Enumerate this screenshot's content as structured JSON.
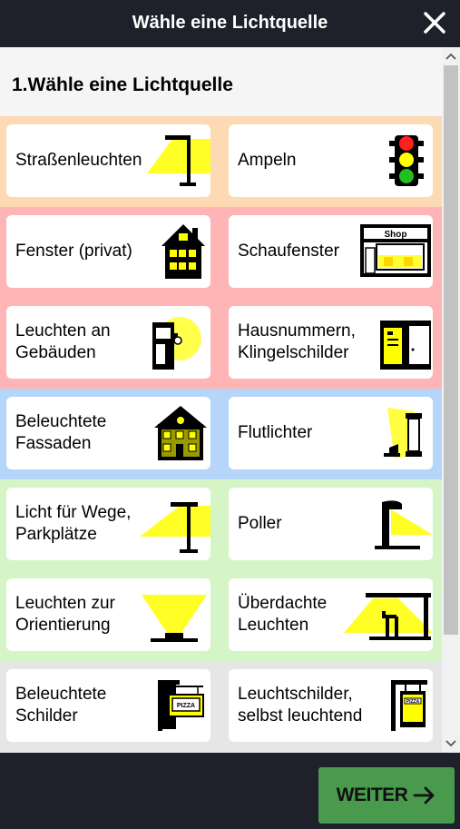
{
  "header": {
    "title": "Wähle eine Lichtquelle",
    "close_icon": "close-icon"
  },
  "main": {
    "section_title": "1.Wähle eine Lichtquelle"
  },
  "colors": {
    "band_orange": "#fdd9b4",
    "band_red": "#ffb5b5",
    "band_blue": "#b5d6f8",
    "band_green": "#d6f5c6",
    "band_gray": "#e6e6e6",
    "light_yellow": "#ffff00",
    "button_green": "#4a9a4e"
  },
  "options": [
    {
      "label": "Straßenleuchten",
      "icon": "street-light-icon"
    },
    {
      "label": "Ampeln",
      "icon": "traffic-light-icon"
    },
    {
      "label": "Fenster (privat)",
      "icon": "house-window-icon"
    },
    {
      "label": "Schaufenster",
      "icon": "shop-window-icon"
    },
    {
      "label": "Leuchten an Gebäuden",
      "icon": "wall-light-icon"
    },
    {
      "label": "Hausnummern, Klingelschilder",
      "icon": "house-number-icon"
    },
    {
      "label": "Beleuchtete Fassaden",
      "icon": "facade-icon"
    },
    {
      "label": "Flutlichter",
      "icon": "floodlight-icon"
    },
    {
      "label": "Licht für Wege, Parkplätze",
      "icon": "path-light-icon"
    },
    {
      "label": "Poller",
      "icon": "bollard-icon"
    },
    {
      "label": "Leuchten zur Orientierung",
      "icon": "ground-light-icon"
    },
    {
      "label": "Überdachte Leuchten",
      "icon": "canopy-light-icon"
    },
    {
      "label": "Beleuchtete Schilder",
      "icon": "lit-sign-icon"
    },
    {
      "label": "Leuchtschilder, selbst leuchtend",
      "icon": "self-lit-sign-icon"
    }
  ],
  "shop_sign": "Shop",
  "pizza_sign": "PIZZA",
  "footer": {
    "next_label": "WEITER"
  }
}
